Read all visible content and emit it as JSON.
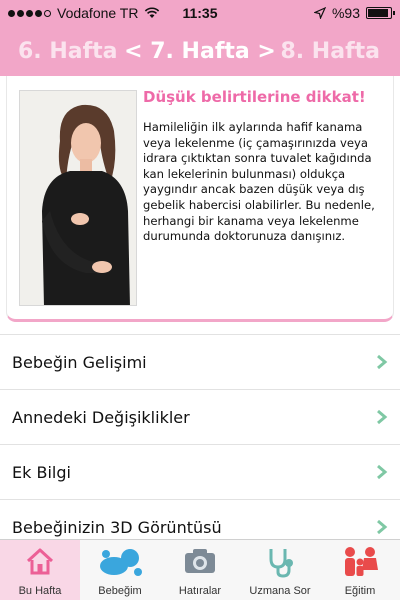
{
  "status_bar": {
    "carrier": "Vodafone TR",
    "time": "11:35",
    "battery": "%93",
    "battery_level": 0.93
  },
  "header": {
    "prev_week": "6. Hafta",
    "current_week": "< 7. Hafta >",
    "next_week": "8. Hafta"
  },
  "card": {
    "title": "Düşük belirtilerine dikkat!",
    "body": "Hamileliğin ilk aylarında hafif kanama veya lekelenme (iç çamaşırınızda veya idrara çıktıktan sonra tuvalet kağıdında kan lekelerinin bulunması) oldukça yaygındır ancak bazen düşük veya dış gebelik habercisi olabilirler. Bu nedenle, herhangi bir kanama veya lekelenme durumunda doktorunuza danışınız."
  },
  "menu": {
    "items": [
      {
        "label": "Bebeğin Gelişimi"
      },
      {
        "label": "Annedeki Değişiklikler"
      },
      {
        "label": "Ek Bilgi"
      },
      {
        "label": "Bebeğinizin 3D Görüntüsü"
      }
    ]
  },
  "tabs": [
    {
      "label": "Bu Hafta",
      "icon": "house-icon",
      "active": true
    },
    {
      "label": "Bebeğim",
      "icon": "baby-icon",
      "active": false
    },
    {
      "label": "Hatıralar",
      "icon": "camera-icon",
      "active": false
    },
    {
      "label": "Uzmana Sor",
      "icon": "stethoscope-icon",
      "active": false
    },
    {
      "label": "Eğitim",
      "icon": "family-icon",
      "active": false
    }
  ],
  "colors": {
    "brand_pink": "#f2a6c8",
    "title_pink": "#ee6aa8",
    "chevron_green": "#7fc8a4",
    "icon_blue": "#3aa6dd",
    "icon_teal": "#6ab7b0",
    "icon_red": "#e94b4b"
  }
}
